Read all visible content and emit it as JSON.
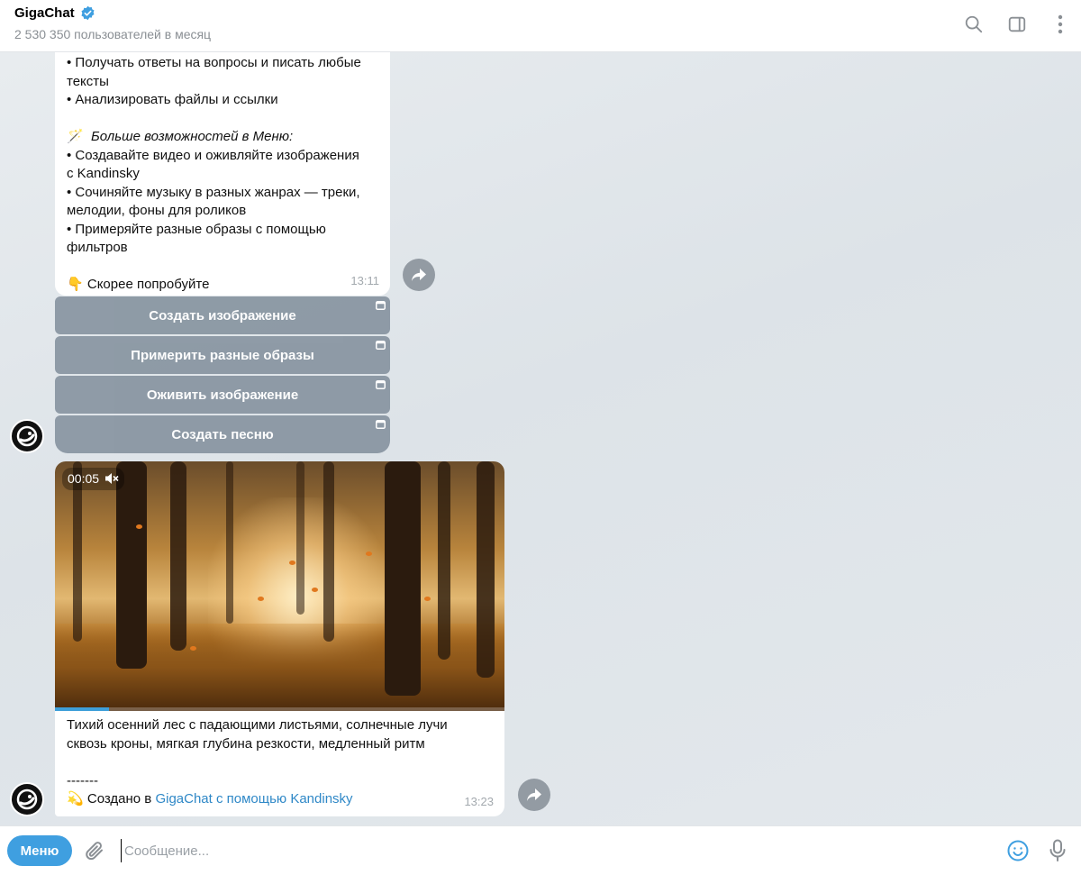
{
  "header": {
    "title": "GigaChat",
    "subtitle": "2 530 350 пользователей в месяц",
    "icons": [
      "verified-icon",
      "search-icon",
      "sidebar-toggle-icon",
      "more-vertical-icon"
    ]
  },
  "messages": [
    {
      "lines": [
        "• Получать ответы на вопросы и писать любые",
        "тексты",
        "• Анализировать файлы и ссылки",
        "",
        "Больше возможностей в Меню:",
        "• Создавайте видео и оживляйте изображения",
        "с Kandinsky",
        "• Сочиняйте музыку в разных жанрах — треки,",
        "мелодии, фоны для роликов",
        "• Примеряйте разные образы с помощью",
        "фильтров",
        "",
        "Скорее попробуйте"
      ],
      "menu_emoji": "🪄",
      "try_emoji": "👇",
      "time": "13:11",
      "keyboard": [
        "Создать изображение",
        "Примерить разные образы",
        "Оживить изображение",
        "Создать песню"
      ]
    },
    {
      "video_time": "00:05",
      "video_progress": 0.12,
      "caption_line1": "Тихий осенний лес с падающими листьями, солнечные лучи",
      "caption_line2": "сквозь кроны, мягкая глубина резкости, медленный ритм",
      "separator": "-------",
      "created_emoji": "💫",
      "created_prefix": " Создано в ",
      "created_link": "GigaChat с помощью Kandinsky",
      "time": "13:23"
    }
  ],
  "input": {
    "menu_label": "Меню",
    "placeholder": "Сообщение..."
  },
  "colors": {
    "accent": "#3f9fe0",
    "link": "#2f88c7",
    "keyboard_button": "#8a97a3",
    "chat_background": "#dde3e8"
  }
}
